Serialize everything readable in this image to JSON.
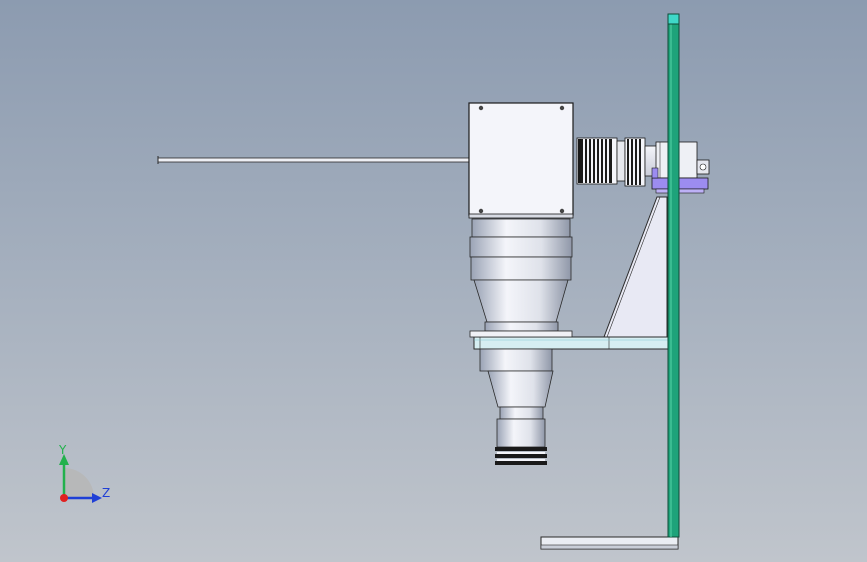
{
  "viewport": {
    "background_top": "#8c9bb0",
    "background_bottom": "#c0c5cc"
  },
  "triad": {
    "y_label": "Y",
    "z_label": "Z",
    "y_color": "#22b14c",
    "z_color": "#1f3fd6",
    "x_color": "#e02020"
  },
  "colors": {
    "column": "#1ea37a",
    "column_cap": "#3fd8c8",
    "shelf": "#d6eef2",
    "clamp": "#9c8cf0",
    "metal_light": "#eef0f5",
    "metal_dark": "#1a1a1a",
    "gusset": "#e8e9f4"
  },
  "icons": {
    "triad": "coordinate-triad-icon"
  }
}
